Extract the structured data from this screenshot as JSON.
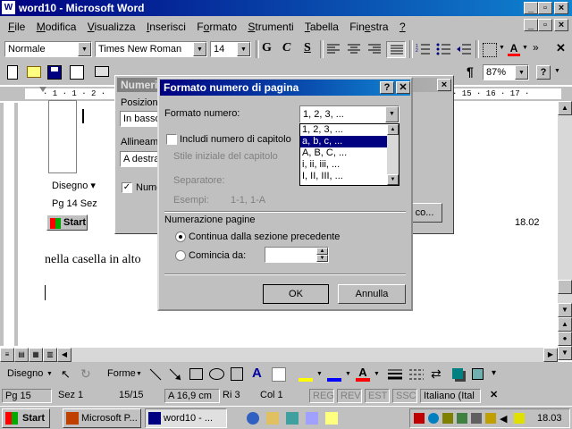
{
  "window": {
    "title": "word10 - Microsoft Word",
    "app_icon": "word-icon"
  },
  "menu": {
    "items": [
      "File",
      "Modifica",
      "Visualizza",
      "Inserisci",
      "Formato",
      "Strumenti",
      "Tabella",
      "Finestra",
      "?"
    ],
    "underline_letters": [
      "F",
      "M",
      "V",
      "I",
      "o",
      "S",
      "T",
      "e",
      "?"
    ]
  },
  "format_toolbar": {
    "style": "Normale",
    "font": "Times New Roman",
    "size": "14",
    "bold": "G",
    "italic": "C",
    "underline": "S"
  },
  "standard_toolbar": {
    "zoom": "87%",
    "help": "?",
    "pilcrow": "¶"
  },
  "ruler": {
    "marks": "· 1 · 1 · 2 ·",
    "marks_right": "· 15 · 16 · 17 ·"
  },
  "document": {
    "text": "nella casella in alto"
  },
  "bg_dialog": {
    "title": "Numeri d",
    "posizione_label": "Posizione",
    "posizione_value": "In basso",
    "allineamento_label": "Allineame",
    "allineamento_value": "A destra",
    "checkbox_label": "Nume",
    "format_button": "co..."
  },
  "bg_inner": {
    "disegno": "Disegno ▾",
    "status": "Pg 14   Sez",
    "start": "Start",
    "clock": "18.02"
  },
  "dialog": {
    "title": "Formato numero di pagina",
    "formato_label": "Formato numero:",
    "formato_value": "1, 2, 3, ...",
    "dropdown_options": [
      "1, 2, 3, ...",
      "a, b, c, ...",
      "A, B, C, ...",
      "i, ii, iii, ...",
      "I, II, III, ..."
    ],
    "selected_option": 1,
    "includi_label": "Includi numero di capitolo",
    "stile_label": "Stile iniziale del capitolo",
    "separatore_label": "Separatore:",
    "esempi_label": "Esempi:",
    "esempi_value": "1-1, 1-A",
    "numerazione_label": "Numerazione pagine",
    "continua_label": "Continua dalla sezione precedente",
    "comincia_label": "Comincia da:",
    "comincia_value": "",
    "ok": "OK",
    "annulla": "Annulla",
    "help_btn": "?",
    "close_btn": "✕"
  },
  "drawing_toolbar": {
    "disegno": "Disegno",
    "forme": "Forme"
  },
  "statusbar": {
    "pg": "Pg 15",
    "sez": "Sez 1",
    "pages": "15/15",
    "pos": "A 16,9 cm",
    "ri": "Ri 3",
    "col": "Col 1",
    "reg": "REG",
    "rev": "REV",
    "est": "EST",
    "ssc": "SSC",
    "lang": "Italiano (Ital"
  },
  "taskbar": {
    "start": "Start",
    "tasks": [
      "Microsoft P...",
      "word10 - ..."
    ],
    "clock": "18.03"
  }
}
